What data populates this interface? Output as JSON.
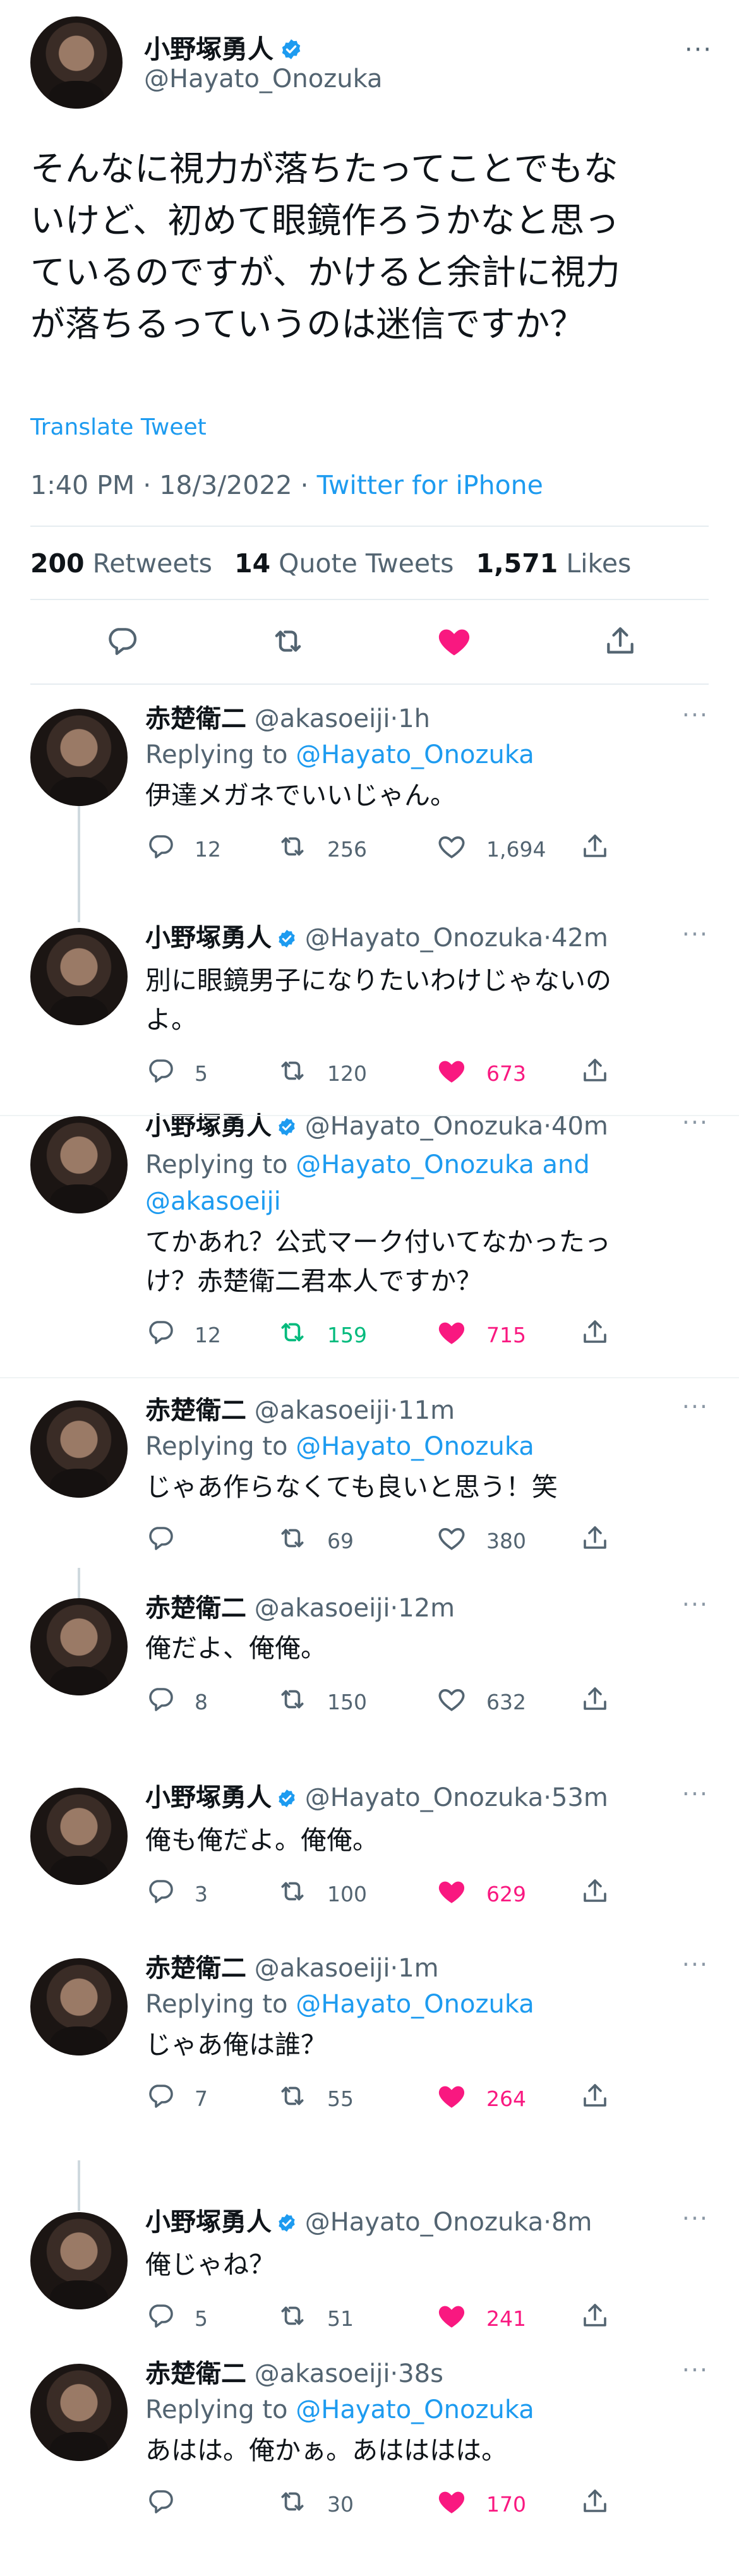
{
  "main_tweet": {
    "author_name": "小野塚勇人",
    "handle": "@Hayato_Onozuka",
    "more_icon": "more-horizontal-icon",
    "text_lines": [
      "そんなに視力が落ちたってことでもな",
      "いけど、初めて眼鏡作ろうかなと思っ",
      "ているのですが、かけると余計に視力",
      "が落ちるっていうのは迷信ですか？"
    ],
    "translate_label": "Translate Tweet",
    "time": "1:40 PM · 18/3/2022 · ",
    "source": "Twitter for iPhone",
    "stats": {
      "retweets": "200",
      "retweets_label": "Retweets",
      "quotes": "14",
      "quotes_label": "Quote Tweets",
      "likes": "1,571",
      "likes_label": "Likes"
    },
    "liked": true
  },
  "replies": [
    {
      "name": "赤楚衛二",
      "verified": false,
      "handle": "@akasoeiji",
      "time": "1h",
      "replying_prefix": "Replying to ",
      "replying_to": "@Hayato_Onozuka",
      "replying_to_2": "",
      "text": "伊達メガネでいいじゃん。",
      "replies": "12",
      "retweets": "256",
      "likes": "1,694",
      "liked": false,
      "retweeted": false
    },
    {
      "name": "小野塚勇人",
      "verified": true,
      "handle": "@Hayato_Onozuka",
      "time": "42m",
      "replying_prefix": "",
      "replying_to": "",
      "replying_to_2": "",
      "text": "別に眼鏡男子になりたいわけじゃないの\nよ。",
      "replies": "5",
      "retweets": "120",
      "likes": "673",
      "liked": true,
      "retweeted": false
    },
    {
      "name": "小野塚勇人",
      "verified": true,
      "handle": "@Hayato_Onozuka",
      "time": "40m",
      "replying_prefix": "Replying to ",
      "replying_to": "@Hayato_Onozuka and",
      "replying_to_2": "@akasoeiji",
      "text": "てかあれ？公式マーク付いてなかったっ\nけ？赤楚衛二君本人ですか？",
      "replies": "12",
      "retweets": "159",
      "likes": "715",
      "liked": true,
      "retweeted": true
    },
    {
      "name": "赤楚衛二",
      "verified": false,
      "handle": "@akasoeiji",
      "time": "11m",
      "replying_prefix": "Replying to ",
      "replying_to": "@Hayato_Onozuka",
      "replying_to_2": "",
      "text": "じゃあ作らなくても良いと思う！笑",
      "replies": "",
      "retweets": "69",
      "likes": "380",
      "liked": false,
      "retweeted": false
    },
    {
      "name": "赤楚衛二",
      "verified": false,
      "handle": "@akasoeiji",
      "time": "12m",
      "replying_prefix": "",
      "replying_to": "",
      "replying_to_2": "",
      "text": "俺だよ、俺俺。",
      "replies": "8",
      "retweets": "150",
      "likes": "632",
      "liked": false,
      "retweeted": false
    },
    {
      "name": "小野塚勇人",
      "verified": true,
      "handle": "@Hayato_Onozuka",
      "time": "53m",
      "replying_prefix": "",
      "replying_to": "",
      "replying_to_2": "",
      "text": "俺も俺だよ。俺俺。",
      "replies": "3",
      "retweets": "100",
      "likes": "629",
      "liked": true,
      "retweeted": false
    },
    {
      "name": "赤楚衛二",
      "verified": false,
      "handle": "@akasoeiji",
      "time": "1m",
      "replying_prefix": "Replying to ",
      "replying_to": "@Hayato_Onozuka",
      "replying_to_2": "",
      "text": "じゃあ俺は誰？",
      "replies": "7",
      "retweets": "55",
      "likes": "264",
      "liked": true,
      "retweeted": false
    },
    {
      "name": "小野塚勇人",
      "verified": true,
      "handle": "@Hayato_Onozuka",
      "time": "8m",
      "replying_prefix": "",
      "replying_to": "",
      "replying_to_2": "",
      "text": "俺じゃね？",
      "replies": "5",
      "retweets": "51",
      "likes": "241",
      "liked": true,
      "retweeted": false
    },
    {
      "name": "赤楚衛二",
      "verified": false,
      "handle": "@akasoeiji",
      "time": "38s",
      "replying_prefix": "Replying to ",
      "replying_to": "@Hayato_Onozuka",
      "replying_to_2": "",
      "text": "あはは。俺かぁ。あはははは。",
      "replies": "",
      "retweets": "30",
      "likes": "170",
      "liked": true,
      "retweeted": false
    }
  ],
  "icons": {
    "reply": "reply-icon",
    "retweet": "retweet-icon",
    "like": "heart-icon",
    "share": "share-icon",
    "verified": "verified-badge-icon"
  },
  "colors": {
    "accent": "#1d9bf0",
    "like": "#f91880",
    "retweet": "#00ba7c",
    "secondary_text": "#536471"
  }
}
